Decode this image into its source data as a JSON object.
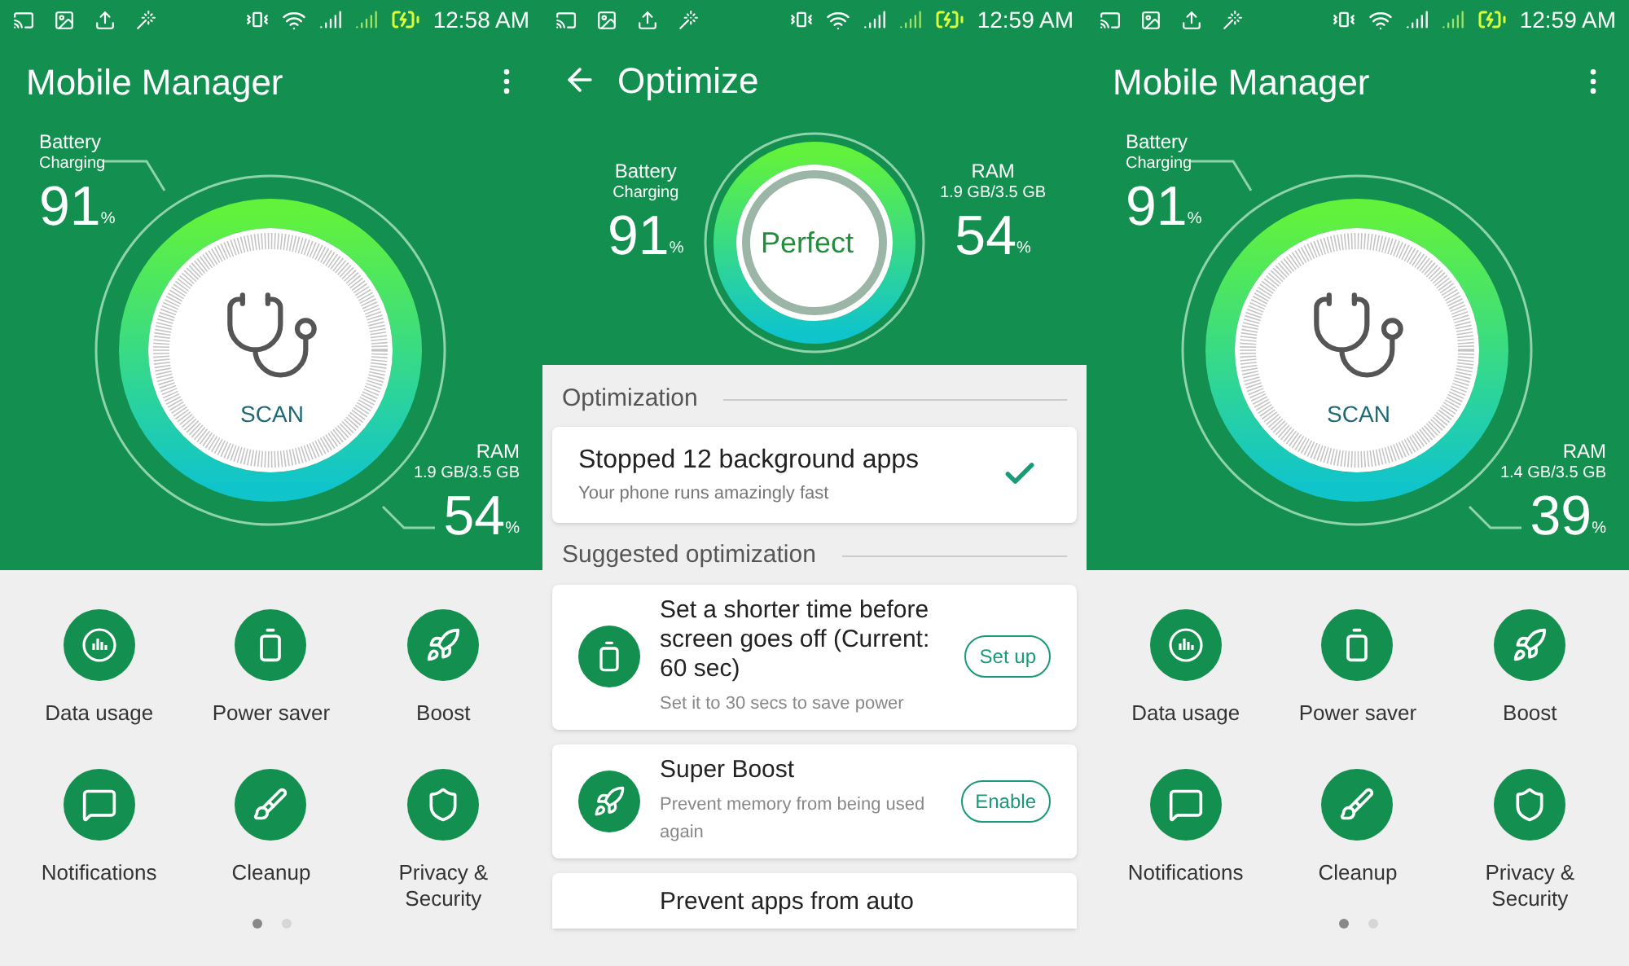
{
  "phones": [
    {
      "kind": "home",
      "status_bar": {
        "time": "12:58 AM"
      },
      "title": "Mobile Manager",
      "battery": {
        "label": "Battery",
        "status": "Charging",
        "value": "91",
        "unit": "%"
      },
      "ram": {
        "label": "RAM",
        "usage": "1.9 GB/3.5 GB",
        "value": "54",
        "unit": "%"
      },
      "scan_label": "SCAN",
      "tiles": [
        {
          "label": "Data usage"
        },
        {
          "label": "Power saver"
        },
        {
          "label": "Boost"
        },
        {
          "label": "Notifications"
        },
        {
          "label": "Cleanup"
        },
        {
          "label": "Privacy & Security"
        }
      ],
      "pages": [
        {
          "selected": true
        },
        {
          "selected": false
        }
      ]
    },
    {
      "kind": "optimize",
      "status_bar": {
        "time": "12:59 AM"
      },
      "title": "Optimize",
      "battery": {
        "label": "Battery",
        "status": "Charging",
        "value": "91",
        "unit": "%"
      },
      "ram": {
        "label": "RAM",
        "usage": "1.9 GB/3.5 GB",
        "value": "54",
        "unit": "%"
      },
      "gauge_label": "Perfect",
      "sections": [
        {
          "title": "Optimization",
          "cards": [
            {
              "kind": "done",
              "title": "Stopped 12 background apps",
              "subtitle": "Your phone runs amazingly fast"
            }
          ]
        },
        {
          "title": "Suggested optimization",
          "cards": [
            {
              "kind": "action",
              "title": "Set a shorter time before screen goes off (Current: 60 sec)",
              "subtitle": "Set it to 30 secs to save power",
              "button": "Set up"
            },
            {
              "kind": "action",
              "title": "Super Boost",
              "subtitle": "Prevent memory from being used again",
              "button": "Enable"
            },
            {
              "kind": "partial",
              "title": "Prevent apps from auto"
            }
          ]
        }
      ]
    },
    {
      "kind": "home",
      "status_bar": {
        "time": "12:59 AM"
      },
      "title": "Mobile Manager",
      "battery": {
        "label": "Battery",
        "status": "Charging",
        "value": "91",
        "unit": "%"
      },
      "ram": {
        "label": "RAM",
        "usage": "1.4 GB/3.5 GB",
        "value": "39",
        "unit": "%"
      },
      "scan_label": "SCAN",
      "tiles": [
        {
          "label": "Data usage"
        },
        {
          "label": "Power saver"
        },
        {
          "label": "Boost"
        },
        {
          "label": "Notifications"
        },
        {
          "label": "Cleanup"
        },
        {
          "label": "Privacy & Security"
        }
      ],
      "pages": [
        {
          "selected": true
        },
        {
          "selected": false
        }
      ]
    }
  ]
}
